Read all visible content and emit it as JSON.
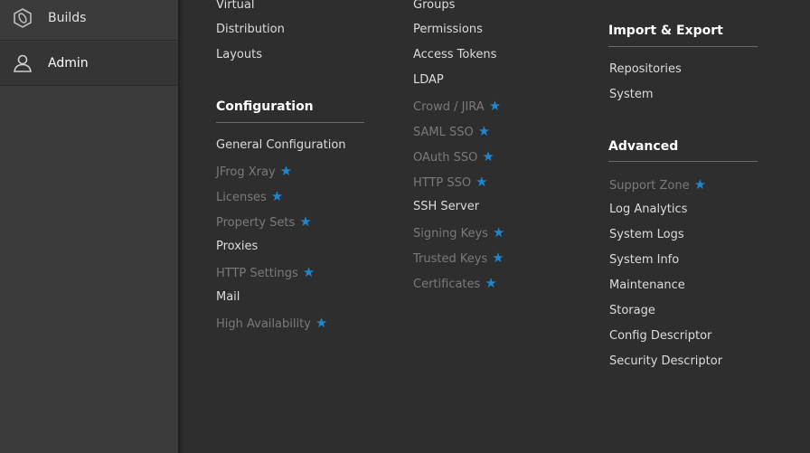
{
  "sidebar": {
    "items": [
      {
        "label": "Builds",
        "icon": "builds-icon"
      },
      {
        "label": "Admin",
        "icon": "admin-icon"
      }
    ]
  },
  "colors": {
    "star": "#1d86d0",
    "dim_text": "#7a7a7a",
    "text": "#dcdcdc"
  },
  "col1": {
    "items_top": [
      {
        "label": "Virtual"
      },
      {
        "label": "Distribution"
      },
      {
        "label": "Layouts"
      }
    ],
    "configuration": {
      "heading": "Configuration",
      "items": [
        {
          "label": "General Configuration",
          "star": false
        },
        {
          "label": "JFrog Xray",
          "star": true
        },
        {
          "label": "Licenses",
          "star": true
        },
        {
          "label": "Property Sets",
          "star": true
        },
        {
          "label": "Proxies",
          "star": false
        },
        {
          "label": "HTTP Settings",
          "star": true
        },
        {
          "label": "Mail",
          "star": false
        },
        {
          "label": "High Availability",
          "star": true
        }
      ]
    }
  },
  "col2": {
    "items": [
      {
        "label": "Groups",
        "star": false
      },
      {
        "label": "Permissions",
        "star": false
      },
      {
        "label": "Access Tokens",
        "star": false
      },
      {
        "label": "LDAP",
        "star": false
      },
      {
        "label": "Crowd / JIRA",
        "star": true
      },
      {
        "label": "SAML SSO",
        "star": true
      },
      {
        "label": "OAuth SSO",
        "star": true
      },
      {
        "label": "HTTP SSO",
        "star": true
      },
      {
        "label": "SSH Server",
        "star": false
      },
      {
        "label": "Signing Keys",
        "star": true
      },
      {
        "label": "Trusted Keys",
        "star": true
      },
      {
        "label": "Certificates",
        "star": true
      }
    ]
  },
  "col3": {
    "import_export": {
      "heading": "Import & Export",
      "items": [
        {
          "label": "Repositories"
        },
        {
          "label": "System"
        }
      ]
    },
    "advanced": {
      "heading": "Advanced",
      "items": [
        {
          "label": "Support Zone",
          "star": true
        },
        {
          "label": "Log Analytics",
          "star": false
        },
        {
          "label": "System Logs",
          "star": false
        },
        {
          "label": "System Info",
          "star": false
        },
        {
          "label": "Maintenance",
          "star": false
        },
        {
          "label": "Storage",
          "star": false
        },
        {
          "label": "Config Descriptor",
          "star": false
        },
        {
          "label": "Security Descriptor",
          "star": false
        }
      ]
    }
  }
}
